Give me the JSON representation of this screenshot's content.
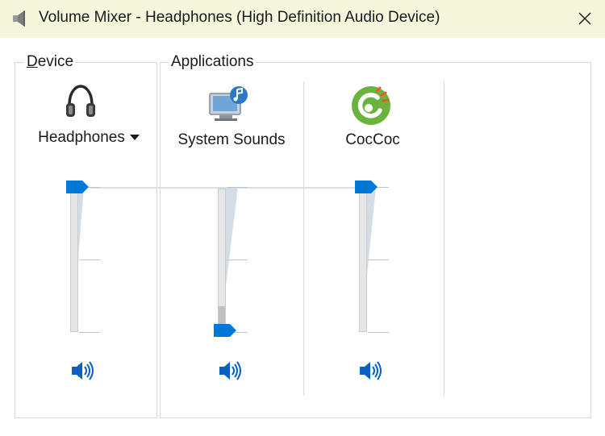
{
  "window": {
    "title": "Volume Mixer - Headphones (High Definition Audio Device)",
    "close_glyph": "✕"
  },
  "device_group": {
    "label": "Device",
    "device_name": "Headphones",
    "icon": "headphones-icon",
    "volume_level": 1.0
  },
  "applications_group": {
    "label": "Applications",
    "apps": [
      {
        "name": "System Sounds",
        "icon": "system-sounds-icon",
        "volume_level": 0.0
      },
      {
        "name": "CocCoc",
        "icon": "coccoc-icon",
        "volume_level": 1.0
      }
    ]
  },
  "colors": {
    "accent": "#0078d7",
    "titlebar_bg": "#f4f7dc",
    "coccoc_green": "#6cb33e",
    "coccoc_orange": "#f15a24"
  }
}
